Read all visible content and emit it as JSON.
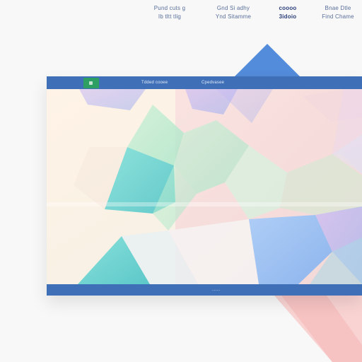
{
  "top_links": [
    {
      "lines": [
        "Pund cuts g",
        "Ib tltt tlig"
      ]
    },
    {
      "lines": [
        "Gnd Si adhy",
        "Ynd Sitamme"
      ]
    },
    {
      "lines": [
        "coooo",
        "3idoio"
      ]
    },
    {
      "lines": [
        "Bnae Dtle",
        "Find Chame"
      ]
    }
  ],
  "window": {
    "tabs": [
      "Tdded cooee",
      "Cpedvasee"
    ],
    "status_text": "........"
  },
  "colors": {
    "titlebar": "#3f6fb7",
    "app_icon": "#2e9f63",
    "accent_blue": "#4a86d9"
  },
  "icons": {
    "app_icon": "square-green-icon"
  }
}
